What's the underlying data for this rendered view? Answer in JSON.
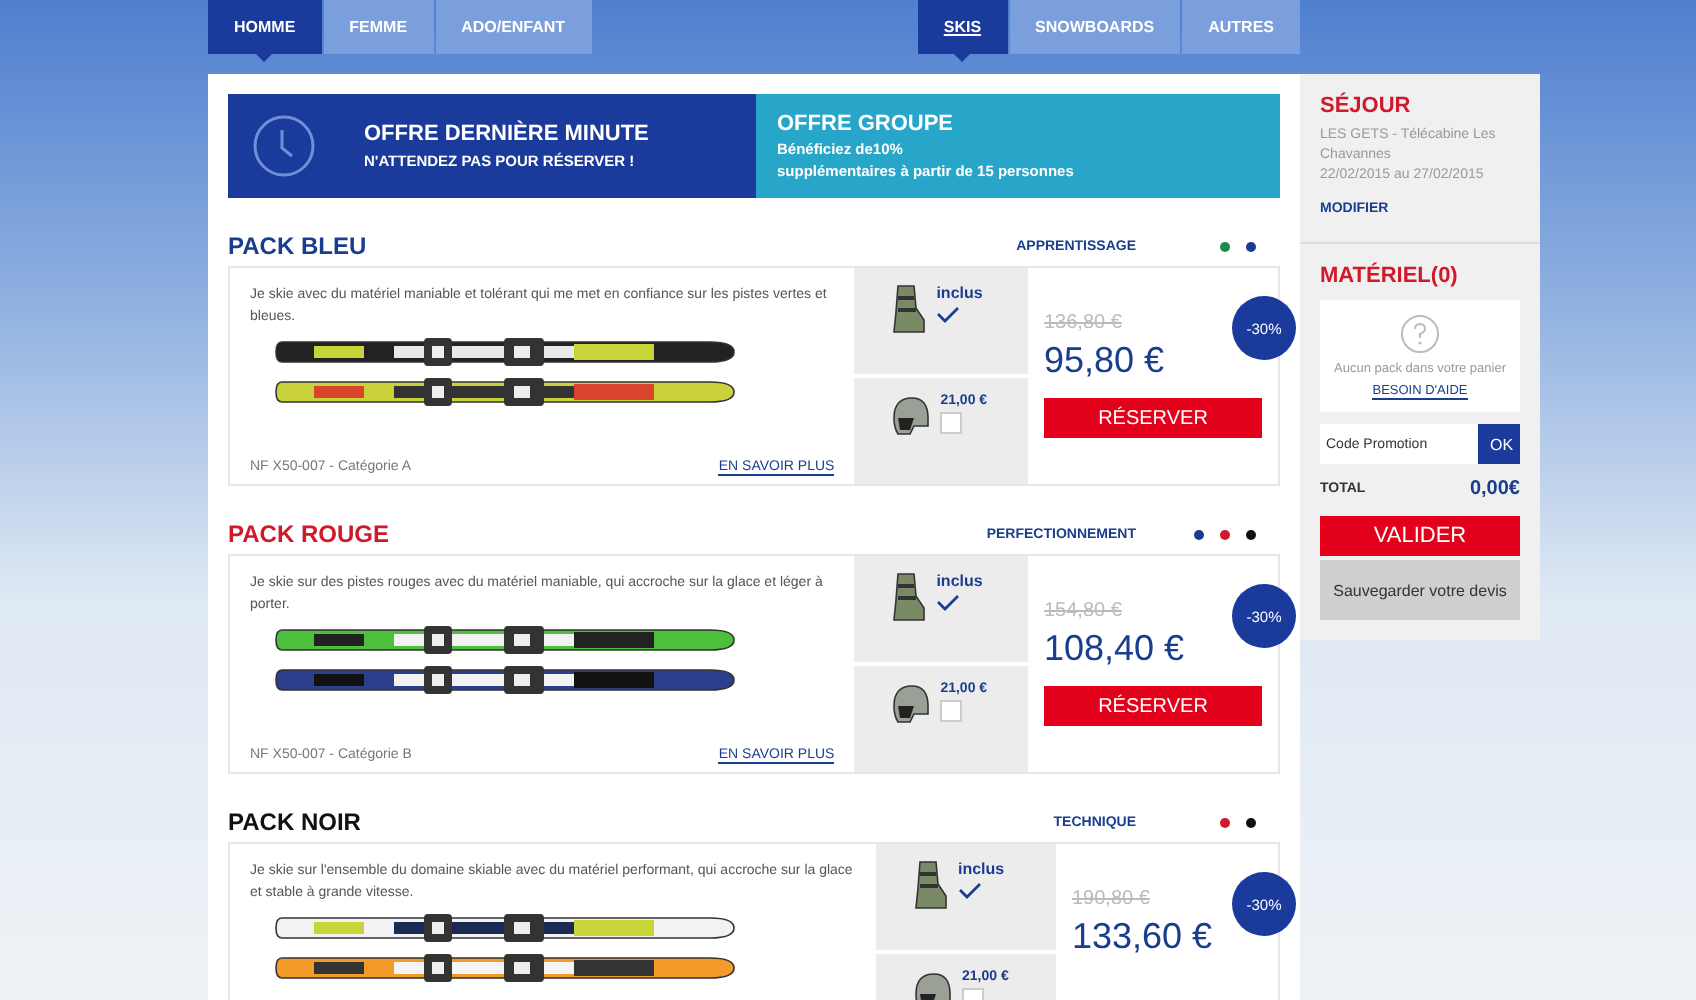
{
  "nav": {
    "categories": [
      {
        "label": "HOMME",
        "selected": true
      },
      {
        "label": "FEMME",
        "selected": false
      },
      {
        "label": "ADO/ENFANT",
        "selected": false
      }
    ],
    "products": [
      {
        "label": "SKIS",
        "selected": true
      },
      {
        "label": "SNOWBOARDS",
        "selected": false
      },
      {
        "label": "AUTRES",
        "selected": false
      }
    ]
  },
  "offers": [
    {
      "kind": "last_minute",
      "title": "OFFRE DERNIÈRE MINUTE",
      "lines": [
        "N'ATTENDEZ PAS POUR RÉSERVER !"
      ]
    },
    {
      "kind": "group",
      "title": "OFFRE GROUPE",
      "lines": [
        "Bénéficiez de10%",
        "supplémentaires à partir de 15 personnes"
      ]
    }
  ],
  "packs": [
    {
      "title": "PACK BLEU",
      "color": "#1a3d8f",
      "level_label": "APPRENTISSAGE",
      "dots": [
        {
          "color": "#1e8a4c"
        },
        {
          "color": "#1a3d8f"
        }
      ],
      "description": "Je skie avec du matériel maniable et tolérant qui me met en confiance sur les pistes vertes et bleues.",
      "norm": "NF X50-007 - Catégorie A",
      "more": "EN SAVOIR PLUS",
      "options": [
        {
          "kind": "boots",
          "label": "inclus",
          "checked": true
        },
        {
          "kind": "helmet",
          "label": "21,00 €",
          "checked": false
        }
      ],
      "old_price": "136,80 €",
      "price": "95,80 €",
      "discount": "-30%",
      "reserve": "RÉSERVER"
    },
    {
      "title": "PACK ROUGE",
      "color": "#d0192b",
      "level_label": "PERFECTIONNEMENT",
      "dots": [
        {
          "color": "#1a3d8f"
        },
        {
          "color": "#d0192b"
        },
        {
          "color": "#111111"
        }
      ],
      "description": "Je skie sur des pistes rouges avec du matériel maniable, qui accroche sur la glace et léger à porter.",
      "norm": "NF X50-007 - Catégorie B",
      "more": "EN SAVOIR PLUS",
      "options": [
        {
          "kind": "boots",
          "label": "inclus",
          "checked": true
        },
        {
          "kind": "helmet",
          "label": "21,00 €",
          "checked": false
        }
      ],
      "old_price": "154,80 €",
      "price": "108,40 €",
      "discount": "-30%",
      "reserve": "RÉSERVER"
    },
    {
      "title": "PACK NOIR",
      "color": "#111111",
      "level_label": "TECHNIQUE",
      "dots": [
        {
          "color": "#d0192b"
        },
        {
          "color": "#111111"
        }
      ],
      "description": "Je skie sur l'ensemble du domaine skiable avec du matériel performant, qui accroche sur la glace et stable à grande vitesse.",
      "options": [
        {
          "kind": "boots",
          "label": "inclus",
          "checked": true
        },
        {
          "kind": "helmet",
          "label": "21,00 €",
          "checked": false
        }
      ],
      "old_price": "190,80 €",
      "price": "133,60 €",
      "discount": "-30%"
    }
  ],
  "sidebar": {
    "stay": {
      "title": "SÉJOUR",
      "lines": [
        "LES GETS - Télécabine Les Chavannes",
        "22/02/2015 au 27/02/2015"
      ],
      "link": "MODIFIER"
    },
    "cart": {
      "title": "MATÉRIEL(0)",
      "empty_text": "Aucun pack dans votre panier",
      "help_link": "BESOIN D'AIDE"
    },
    "promo": {
      "placeholder": "Code Promotion",
      "button": "OK"
    },
    "total": {
      "label": "TOTAL",
      "value": "0,00€"
    },
    "validate": "VALIDER",
    "save": "Sauvegarder votre devis"
  }
}
